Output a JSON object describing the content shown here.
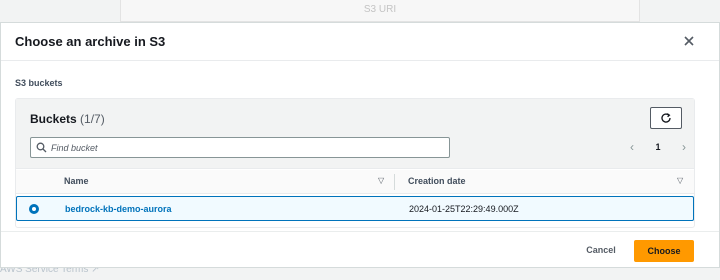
{
  "backdrop": {
    "field_label": "S3 URI",
    "link_text": "AWS Service Terms"
  },
  "modal": {
    "title": "Choose an archive in S3",
    "close_icon": "close-icon"
  },
  "section_label": "S3 buckets",
  "table": {
    "title": "Buckets",
    "count": "(1/7)",
    "refresh_icon": "refresh-icon",
    "search": {
      "placeholder": "Find bucket",
      "value": ""
    },
    "pagination": {
      "prev_icon": "chevron-left-icon",
      "page": "1",
      "next_icon": "chevron-right-icon"
    },
    "columns": [
      "Name",
      "Creation date"
    ],
    "rows": [
      {
        "selected": true,
        "name": "bedrock-kb-demo-aurora",
        "creation_date": "2024-01-25T22:29:49.000Z"
      }
    ]
  },
  "footer": {
    "cancel_label": "Cancel",
    "choose_label": "Choose"
  },
  "colors": {
    "accent": "#0073bb",
    "primary_button": "#ff9900",
    "selected_row_bg": "#f1faff"
  }
}
